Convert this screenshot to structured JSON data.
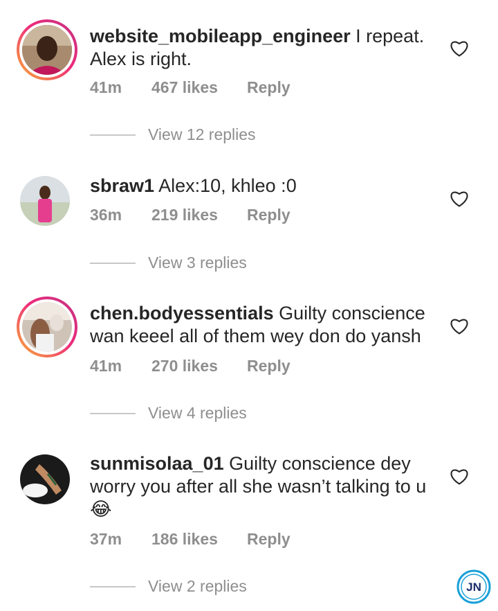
{
  "comments": [
    {
      "username": "website_mobileapp_engineer",
      "text": "I repeat. Alex is right.",
      "time": "41m",
      "likes": "467 likes",
      "reply": "Reply",
      "view_replies": "View 12 replies",
      "story_ring": true
    },
    {
      "username": "sbraw1",
      "text": "Alex:10, khleo :0",
      "time": "36m",
      "likes": "219 likes",
      "reply": "Reply",
      "view_replies": "View 3 replies",
      "story_ring": false
    },
    {
      "username": "chen.bodyessentials",
      "text": "Guilty conscience wan keeel all of them wey don do yansh",
      "time": "41m",
      "likes": "270 likes",
      "reply": "Reply",
      "view_replies": "View 4 replies",
      "story_ring": true
    },
    {
      "username": "sunmisolaa_01",
      "text": "Guilty conscience dey worry you after all she wasn’t talking to u😂",
      "time": "37m",
      "likes": "186 likes",
      "reply": "Reply",
      "view_replies": "View 2 replies",
      "story_ring": false
    }
  ],
  "watermark": {
    "text": "JN"
  },
  "colors": {
    "story_ring_start": "#f9b233",
    "story_ring_end": "#c13584",
    "meta_gray": "#8e8e8e",
    "watermark_blue": "#1aa0d8"
  }
}
